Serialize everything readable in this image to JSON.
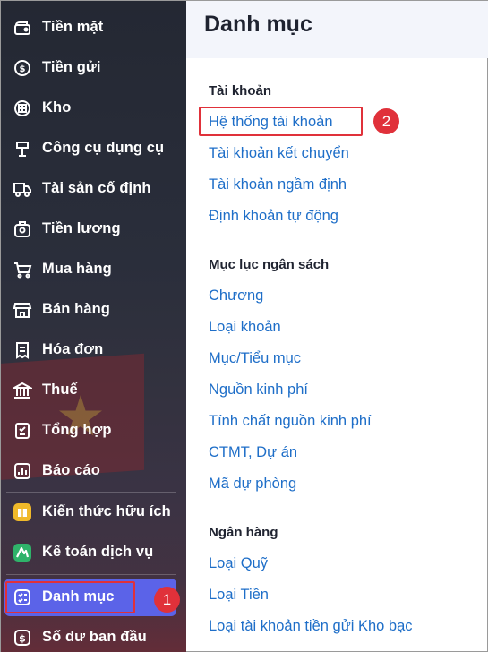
{
  "sidebar": {
    "items": [
      {
        "label": "Tiền mặt",
        "icon": "cash-icon"
      },
      {
        "label": "Tiền gửi",
        "icon": "deposit-icon"
      },
      {
        "label": "Kho",
        "icon": "warehouse-icon"
      },
      {
        "label": "Công cụ dụng cụ",
        "icon": "tools-icon"
      },
      {
        "label": "Tài sản cố định",
        "icon": "truck-icon"
      },
      {
        "label": "Tiền lương",
        "icon": "salary-icon"
      },
      {
        "label": "Mua hàng",
        "icon": "cart-icon"
      },
      {
        "label": "Bán hàng",
        "icon": "store-icon"
      },
      {
        "label": "Hóa đơn",
        "icon": "invoice-icon"
      },
      {
        "label": "Thuế",
        "icon": "bank-icon"
      },
      {
        "label": "Tổng hợp",
        "icon": "summary-icon"
      },
      {
        "label": "Báo cáo",
        "icon": "report-icon"
      },
      {
        "label": "Kiến thức hữu ích",
        "icon": "book-icon"
      },
      {
        "label": "Kế toán dịch vụ",
        "icon": "service-icon"
      },
      {
        "label": "Danh mục",
        "icon": "list-icon"
      },
      {
        "label": "Số dư ban đầu",
        "icon": "balance-icon"
      }
    ],
    "badge_1": "1"
  },
  "main": {
    "title": "Danh mục",
    "badge_2": "2",
    "sections": [
      {
        "title": "Tài khoản",
        "links": [
          "Hệ thống tài khoản",
          "Tài khoản kết chuyển",
          "Tài khoản ngầm định",
          "Định khoản tự động"
        ]
      },
      {
        "title": "Mục lục ngân sách",
        "links": [
          "Chương",
          "Loại khoản",
          "Mục/Tiểu mục",
          "Nguồn kinh phí",
          "Tính chất nguồn kinh phí",
          "CTMT, Dự án",
          "Mã dự phòng"
        ]
      },
      {
        "title": "Ngân hàng",
        "links": [
          "Loại Quỹ",
          "Loại Tiền",
          "Loại tài khoản tiền gửi Kho bạc"
        ]
      }
    ]
  },
  "colors": {
    "accent": "#5b63e8",
    "link": "#1e6ec8",
    "highlight": "#e0313a"
  }
}
